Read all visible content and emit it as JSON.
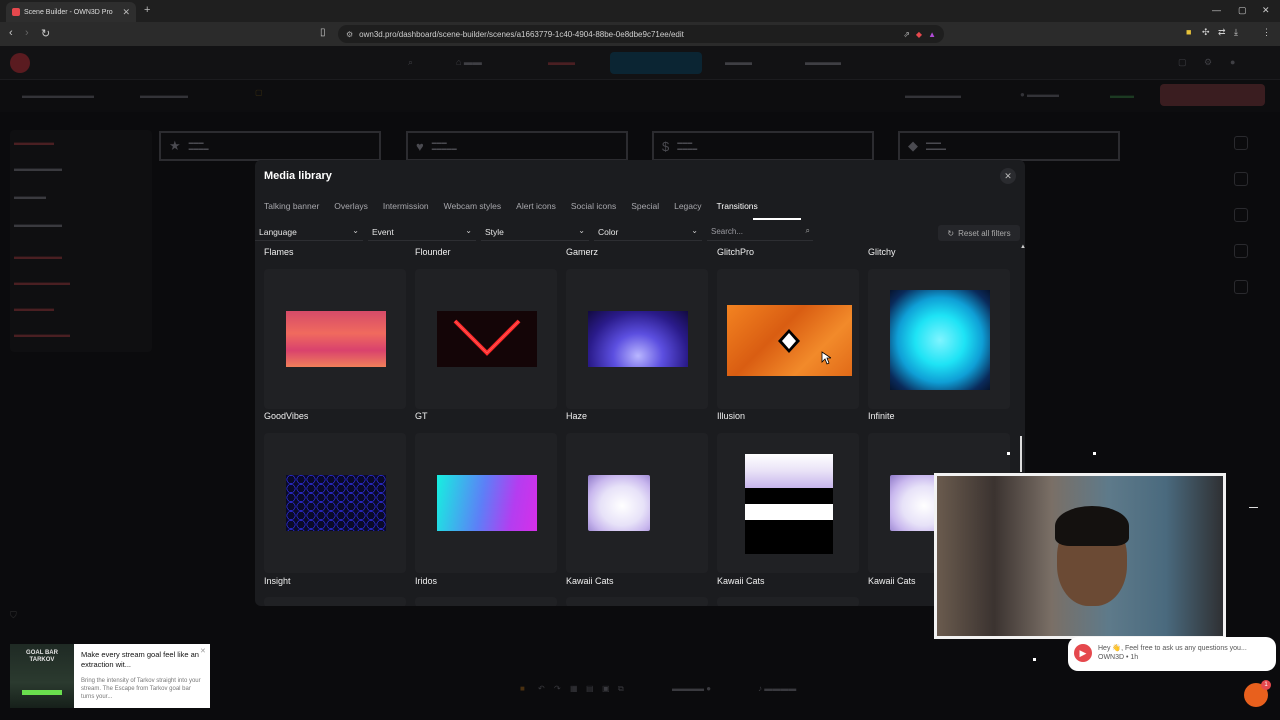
{
  "browser": {
    "tab_title": "Scene Builder - OWN3D Pro",
    "url": "own3d.pro/dashboard/scene-builder/scenes/a1663779-1c40-4904-88be-0e8dbe9c71ee/edit"
  },
  "modal": {
    "title": "Media library",
    "tabs": [
      "Talking banner",
      "Overlays",
      "Intermission",
      "Webcam styles",
      "Alert icons",
      "Social icons",
      "Special",
      "Legacy",
      "Transitions"
    ],
    "active_tab": "Transitions",
    "filters": {
      "language": "Language",
      "event": "Event",
      "style": "Style",
      "color": "Color",
      "search_placeholder": "Search...",
      "reset": "Reset all filters"
    },
    "row1_labels": [
      "Flames",
      "Flounder",
      "Gamerz",
      "GlitchPro",
      "Glitchy"
    ],
    "row2_labels": [
      "GoodVibes",
      "GT",
      "Haze",
      "Illusion",
      "Infinite"
    ],
    "row3_labels": [
      "Insight",
      "Iridos",
      "Kawaii Cats",
      "Kawaii Cats",
      "Kawaii Cats"
    ]
  },
  "chat": {
    "message": "Hey 👋, Feel free to ask us any questions you...",
    "meta": "OWN3D • 1h",
    "badge": "1"
  },
  "promo": {
    "image_text": "GOAL BAR TARKOV",
    "title": "Make every stream goal feel like an extraction wit...",
    "body": "Bring the intensity of Tarkov straight into your stream. The Escape from Tarkov goal bar turns your..."
  },
  "colors": {
    "modal_bg": "#1b1c1f",
    "accent_orange": "#f38321",
    "brand_red": "#e5484d"
  }
}
